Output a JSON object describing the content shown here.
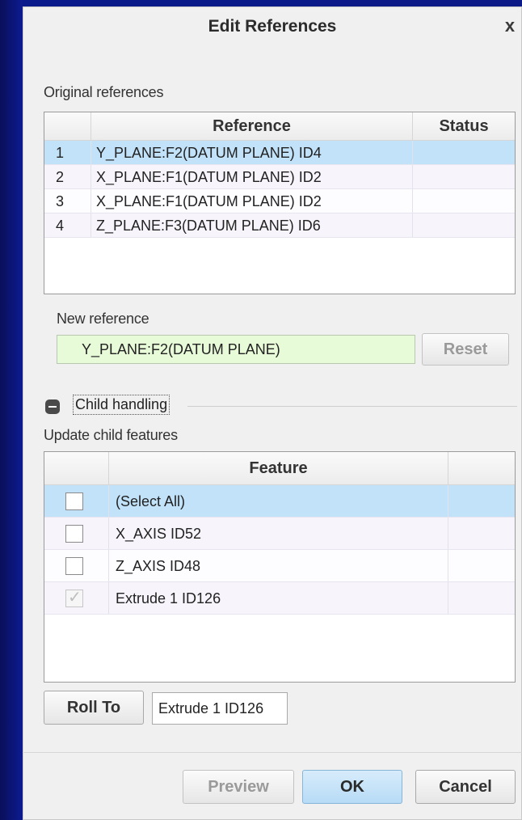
{
  "dialog": {
    "title": "Edit References",
    "close_label": "x"
  },
  "original_references": {
    "label": "Original references",
    "columns": [
      "",
      "Reference",
      "Status"
    ],
    "rows": [
      {
        "num": "1",
        "reference": "Y_PLANE:F2(DATUM PLANE) ID4",
        "status": ""
      },
      {
        "num": "2",
        "reference": "X_PLANE:F1(DATUM PLANE) ID2",
        "status": ""
      },
      {
        "num": "3",
        "reference": "X_PLANE:F1(DATUM PLANE) ID2",
        "status": ""
      },
      {
        "num": "4",
        "reference": "Z_PLANE:F3(DATUM PLANE) ID6",
        "status": ""
      }
    ]
  },
  "new_reference": {
    "label": "New reference",
    "value": "Y_PLANE:F2(DATUM PLANE)",
    "reset_label": "Reset"
  },
  "child_handling": {
    "label": "Child handling",
    "update_label": "Update child features",
    "columns": [
      "",
      "Feature",
      ""
    ],
    "rows": [
      {
        "feature": "(Select All)",
        "checked": false
      },
      {
        "feature": "X_AXIS ID52",
        "checked": false
      },
      {
        "feature": "Z_AXIS ID48",
        "checked": false
      },
      {
        "feature": "Extrude 1 ID126",
        "checked": true
      }
    ]
  },
  "roll_to": {
    "button_label": "Roll To",
    "value": "Extrude 1 ID126"
  },
  "footer": {
    "preview_label": "Preview",
    "ok_label": "OK",
    "cancel_label": "Cancel"
  }
}
